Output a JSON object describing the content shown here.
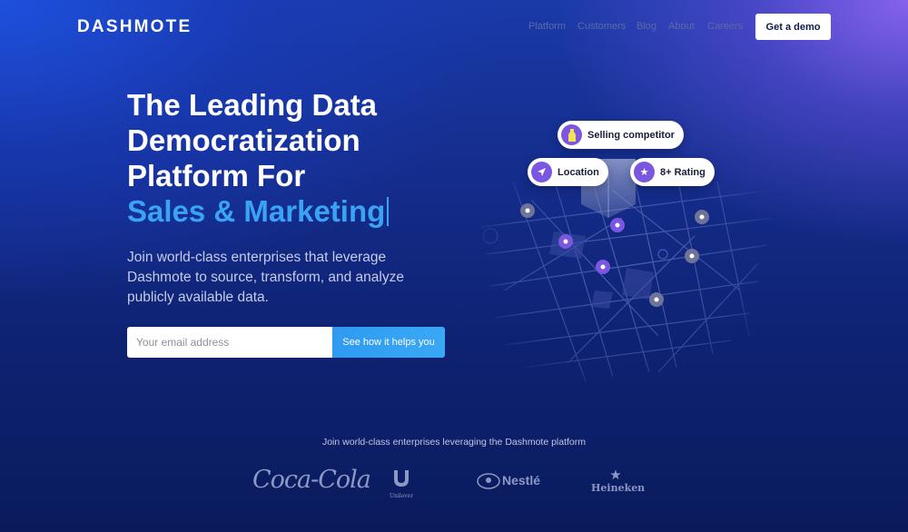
{
  "brand": {
    "name": "DASHMOTE"
  },
  "nav": {
    "items": [
      "Platform",
      "Customers",
      "Blog",
      "About",
      "Careers"
    ],
    "demo_label": "Get a demo"
  },
  "hero": {
    "title_line1": "The Leading Data",
    "title_line2": "Democratization",
    "title_line3": "Platform For",
    "title_accent": "Sales & Marketing",
    "subtitle": "Join world-class enterprises that leverage Dashmote to source, transform, and analyze publicly available data.",
    "email_placeholder": "Your email address",
    "cta_label": "See how it helps you"
  },
  "map": {
    "pills": [
      {
        "label": "Selling competitor",
        "icon": "bottle-icon"
      },
      {
        "label": "Location",
        "icon": "location-arrow-icon"
      },
      {
        "label": "8+ Rating",
        "icon": "star-icon"
      }
    ]
  },
  "trust": {
    "text": "Join world-class enterprises leveraging the Dashmote platform",
    "logos": [
      "Coca-Cola",
      "Unilever",
      "Nestlé",
      "Heineken"
    ]
  },
  "colors": {
    "accent": "#3aa3f5",
    "pill_icon": "#7b57e0",
    "background": "#0e2272"
  }
}
